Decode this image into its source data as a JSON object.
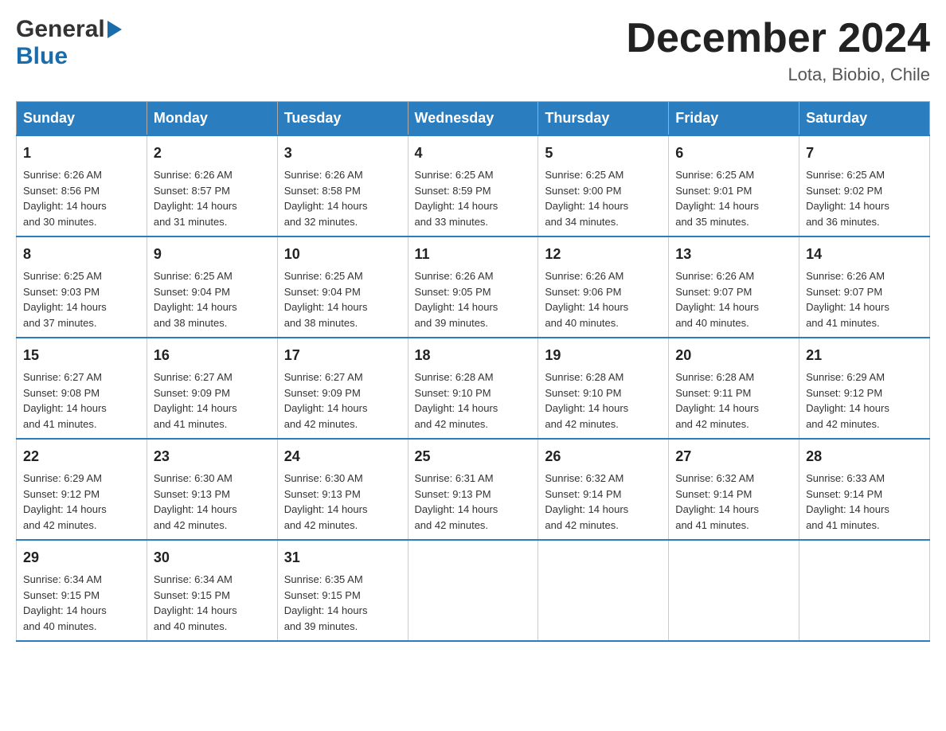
{
  "logo": {
    "general": "General",
    "blue": "Blue"
  },
  "title": "December 2024",
  "location": "Lota, Biobio, Chile",
  "days_of_week": [
    "Sunday",
    "Monday",
    "Tuesday",
    "Wednesday",
    "Thursday",
    "Friday",
    "Saturday"
  ],
  "weeks": [
    [
      {
        "day": "1",
        "sunrise": "6:26 AM",
        "sunset": "8:56 PM",
        "daylight": "14 hours and 30 minutes."
      },
      {
        "day": "2",
        "sunrise": "6:26 AM",
        "sunset": "8:57 PM",
        "daylight": "14 hours and 31 minutes."
      },
      {
        "day": "3",
        "sunrise": "6:26 AM",
        "sunset": "8:58 PM",
        "daylight": "14 hours and 32 minutes."
      },
      {
        "day": "4",
        "sunrise": "6:25 AM",
        "sunset": "8:59 PM",
        "daylight": "14 hours and 33 minutes."
      },
      {
        "day": "5",
        "sunrise": "6:25 AM",
        "sunset": "9:00 PM",
        "daylight": "14 hours and 34 minutes."
      },
      {
        "day": "6",
        "sunrise": "6:25 AM",
        "sunset": "9:01 PM",
        "daylight": "14 hours and 35 minutes."
      },
      {
        "day": "7",
        "sunrise": "6:25 AM",
        "sunset": "9:02 PM",
        "daylight": "14 hours and 36 minutes."
      }
    ],
    [
      {
        "day": "8",
        "sunrise": "6:25 AM",
        "sunset": "9:03 PM",
        "daylight": "14 hours and 37 minutes."
      },
      {
        "day": "9",
        "sunrise": "6:25 AM",
        "sunset": "9:04 PM",
        "daylight": "14 hours and 38 minutes."
      },
      {
        "day": "10",
        "sunrise": "6:25 AM",
        "sunset": "9:04 PM",
        "daylight": "14 hours and 38 minutes."
      },
      {
        "day": "11",
        "sunrise": "6:26 AM",
        "sunset": "9:05 PM",
        "daylight": "14 hours and 39 minutes."
      },
      {
        "day": "12",
        "sunrise": "6:26 AM",
        "sunset": "9:06 PM",
        "daylight": "14 hours and 40 minutes."
      },
      {
        "day": "13",
        "sunrise": "6:26 AM",
        "sunset": "9:07 PM",
        "daylight": "14 hours and 40 minutes."
      },
      {
        "day": "14",
        "sunrise": "6:26 AM",
        "sunset": "9:07 PM",
        "daylight": "14 hours and 41 minutes."
      }
    ],
    [
      {
        "day": "15",
        "sunrise": "6:27 AM",
        "sunset": "9:08 PM",
        "daylight": "14 hours and 41 minutes."
      },
      {
        "day": "16",
        "sunrise": "6:27 AM",
        "sunset": "9:09 PM",
        "daylight": "14 hours and 41 minutes."
      },
      {
        "day": "17",
        "sunrise": "6:27 AM",
        "sunset": "9:09 PM",
        "daylight": "14 hours and 42 minutes."
      },
      {
        "day": "18",
        "sunrise": "6:28 AM",
        "sunset": "9:10 PM",
        "daylight": "14 hours and 42 minutes."
      },
      {
        "day": "19",
        "sunrise": "6:28 AM",
        "sunset": "9:10 PM",
        "daylight": "14 hours and 42 minutes."
      },
      {
        "day": "20",
        "sunrise": "6:28 AM",
        "sunset": "9:11 PM",
        "daylight": "14 hours and 42 minutes."
      },
      {
        "day": "21",
        "sunrise": "6:29 AM",
        "sunset": "9:12 PM",
        "daylight": "14 hours and 42 minutes."
      }
    ],
    [
      {
        "day": "22",
        "sunrise": "6:29 AM",
        "sunset": "9:12 PM",
        "daylight": "14 hours and 42 minutes."
      },
      {
        "day": "23",
        "sunrise": "6:30 AM",
        "sunset": "9:13 PM",
        "daylight": "14 hours and 42 minutes."
      },
      {
        "day": "24",
        "sunrise": "6:30 AM",
        "sunset": "9:13 PM",
        "daylight": "14 hours and 42 minutes."
      },
      {
        "day": "25",
        "sunrise": "6:31 AM",
        "sunset": "9:13 PM",
        "daylight": "14 hours and 42 minutes."
      },
      {
        "day": "26",
        "sunrise": "6:32 AM",
        "sunset": "9:14 PM",
        "daylight": "14 hours and 42 minutes."
      },
      {
        "day": "27",
        "sunrise": "6:32 AM",
        "sunset": "9:14 PM",
        "daylight": "14 hours and 41 minutes."
      },
      {
        "day": "28",
        "sunrise": "6:33 AM",
        "sunset": "9:14 PM",
        "daylight": "14 hours and 41 minutes."
      }
    ],
    [
      {
        "day": "29",
        "sunrise": "6:34 AM",
        "sunset": "9:15 PM",
        "daylight": "14 hours and 40 minutes."
      },
      {
        "day": "30",
        "sunrise": "6:34 AM",
        "sunset": "9:15 PM",
        "daylight": "14 hours and 40 minutes."
      },
      {
        "day": "31",
        "sunrise": "6:35 AM",
        "sunset": "9:15 PM",
        "daylight": "14 hours and 39 minutes."
      },
      null,
      null,
      null,
      null
    ]
  ],
  "sunrise_label": "Sunrise:",
  "sunset_label": "Sunset:",
  "daylight_label": "Daylight:"
}
